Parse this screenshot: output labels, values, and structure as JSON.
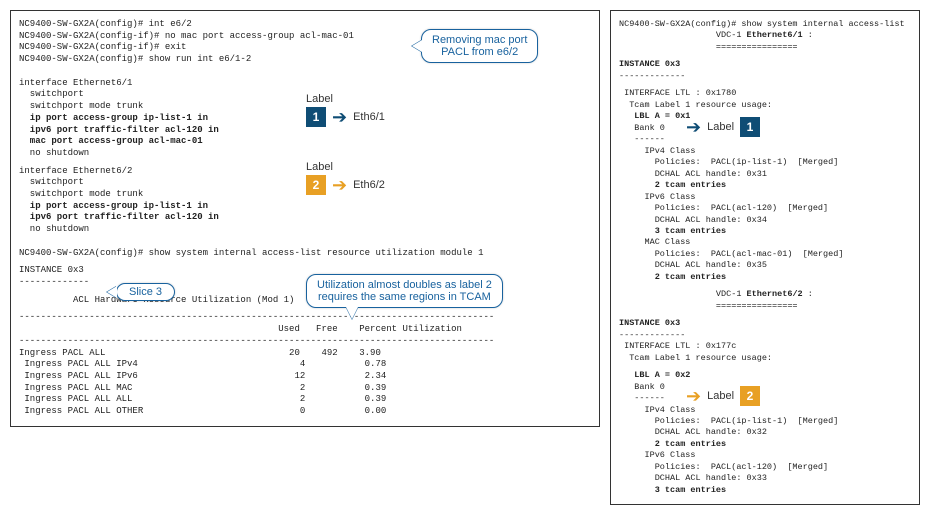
{
  "left": {
    "cli": {
      "l1": "NC9400-SW-GX2A(config)# int e6/2",
      "l2": "NC9400-SW-GX2A(config-if)# no mac port access-group acl-mac-01",
      "l3": "NC9400-SW-GX2A(config-if)# exit",
      "l4": "NC9400-SW-GX2A(config)# show run int e6/1-2"
    },
    "if1": {
      "h": "interface Ethernet6/1",
      "a": "  switchport",
      "b": "  switchport mode trunk",
      "c": "  ip port access-group ip-list-1 in",
      "d": "  ipv6 port traffic-filter acl-120 in",
      "e": "  mac port access-group acl-mac-01",
      "f": "  no shutdown"
    },
    "if2": {
      "h": "interface Ethernet6/2",
      "a": "  switchport",
      "b": "  switchport mode trunk",
      "c": "  ip port access-group ip-list-1 in",
      "d": "  ipv6 port traffic-filter acl-120 in",
      "f": "  no shutdown"
    },
    "show2": "NC9400-SW-GX2A(config)# show system internal access-list resource utilization module 1",
    "inst": "INSTANCE 0x3",
    "dash": "-------------",
    "tabletitle": "          ACL Hardware Resource Utilization (Mod 1)",
    "ruleLong": "----------------------------------------------------------------------------------------",
    "hdr": "                                                Used   Free    Percent Utilization",
    "rows": {
      "r1": "Ingress PACL ALL                                  20    492    3.90",
      "r2": " Ingress PACL ALL IPv4                              4           0.78",
      "r3": " Ingress PACL ALL IPv6                             12           2.34",
      "r4": " Ingress PACL ALL MAC                               2           0.39",
      "r5": " Ingress PACL ALL ALL                               2           0.39",
      "r6": " Ingress PACL ALL OTHER                             0           0.00"
    },
    "labels": {
      "label_word": "Label",
      "eth1": "Eth6/1",
      "eth2": "Eth6/2",
      "badge1": "1",
      "badge2": "2"
    },
    "callouts": {
      "c1a": "Removing mac port",
      "c1b": "PACL from e6/2",
      "c2": "Slice 3",
      "c3a": "Utilization almost doubles as label 2",
      "c3b": "requires the same regions in TCAM"
    }
  },
  "right": {
    "l1": "NC9400-SW-GX2A(config)# show system internal access-list",
    "l2": "                   VDC-1 Ethernet6/1 :",
    "l3": "                   ================",
    "inst": "INSTANCE 0x3",
    "d13": "-------------",
    "ltl1": " INTERFACE LTL : 0x1780",
    "tcam1": "  Tcam Label 1 resource usage:",
    "lblA1": "   LBL A = 0x1",
    "bank": "   Bank 0",
    "d6": "   ------",
    "ipv4c": "     IPv4 Class",
    "p_ip1": "       Policies:  PACL(ip-list-1)  [Merged]",
    "h31": "       DCHAL ACL handle: 0x31",
    "t2": "       2 tcam entries",
    "ipv6c": "     IPv6 Class",
    "p_120": "       Policies:  PACL(acl-120)  [Merged]",
    "h34": "       DCHAL ACL handle: 0x34",
    "t3": "       3 tcam entries",
    "macc": "     MAC Class",
    "p_mac": "       Policies:  PACL(acl-mac-01)  [Merged]",
    "h35": "       DCHAL ACL handle: 0x35",
    "eth62_h": "                   VDC-1 Ethernet6/2 :",
    "eth62_r": "                   ================",
    "ltl2": " INTERFACE LTL : 0x177c",
    "lblA2": "   LBL A = 0x2",
    "h32": "       DCHAL ACL handle: 0x32",
    "h33": "       DCHAL ACL handle: 0x33",
    "labels": {
      "label_word": "Label",
      "badge1": "1",
      "badge2": "2"
    }
  }
}
